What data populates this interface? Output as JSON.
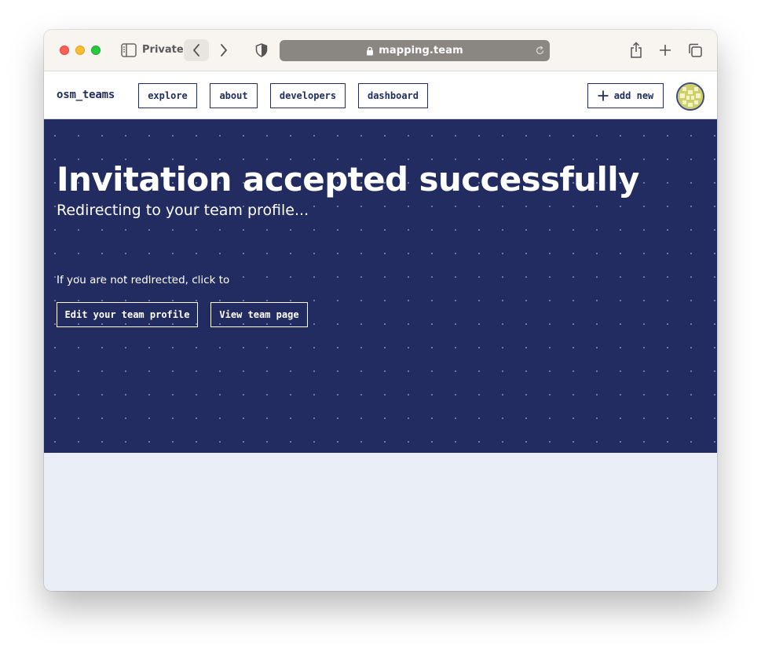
{
  "browser": {
    "private_label": "Private",
    "url": "mapping.team"
  },
  "header": {
    "brand": "osm_teams",
    "nav": [
      "explore",
      "about",
      "developers",
      "dashboard"
    ],
    "add_new_label": "add new"
  },
  "hero": {
    "title": "Invitation accepted successfully",
    "subtitle": "Redirecting to your team profile...",
    "note": "If you are not redirected, click to",
    "edit_button": "Edit your team profile",
    "view_button": "View team page"
  },
  "colors": {
    "brand_navy": "#232c61",
    "page_background": "#eaeef7",
    "avatar_tile": "#cfcf6a"
  },
  "icons": [
    "sidebar-icon",
    "chevron-left-icon",
    "chevron-right-icon",
    "shield-icon",
    "lock-icon",
    "reload-icon",
    "share-icon",
    "plus-icon",
    "tabs-icon",
    "avatar-identicon"
  ]
}
